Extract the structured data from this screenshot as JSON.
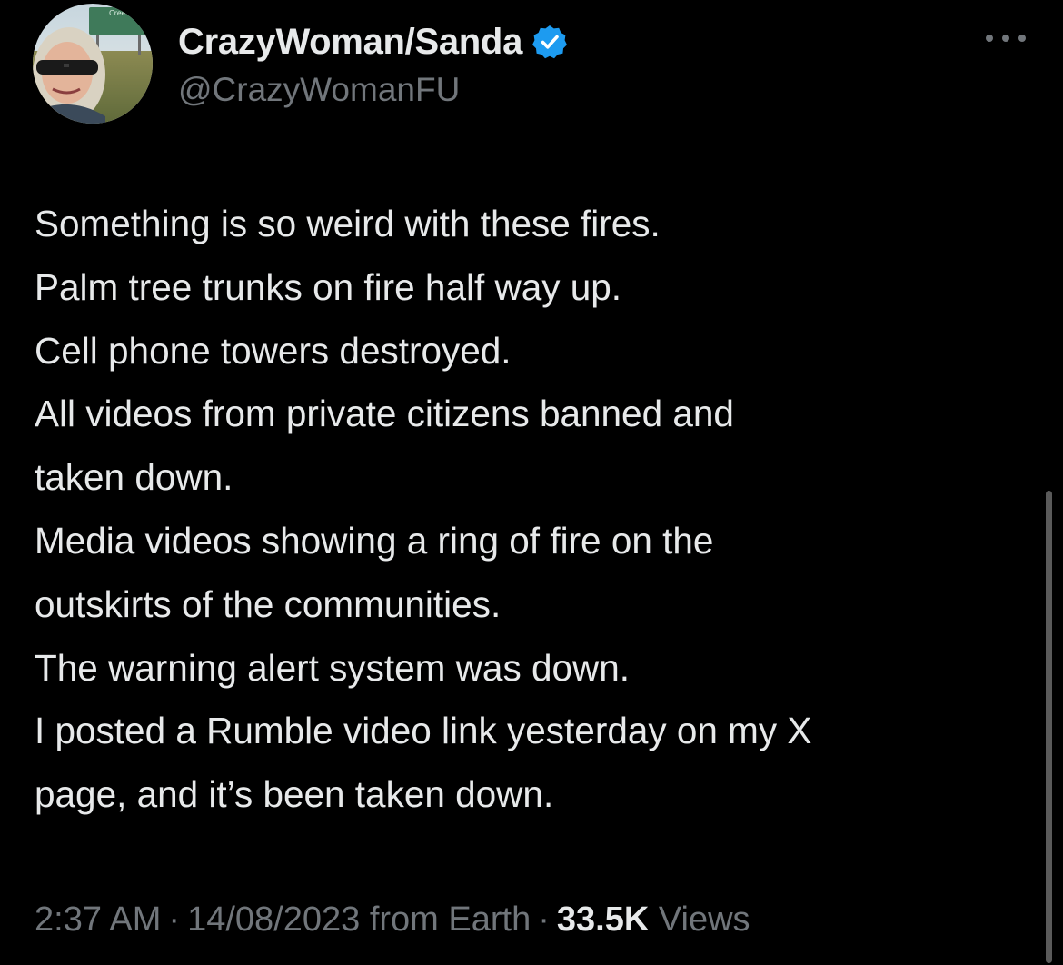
{
  "author": {
    "display_name": "CrazyWoman/Sanda",
    "handle": "@CrazyWomanFU",
    "verified": true,
    "avatar_sign_text": "Creek"
  },
  "more_icon": "more-horizontal-icon",
  "tweet": {
    "lines": [
      "Something is so weird with these fires.",
      "Palm tree trunks on fire half way up.",
      "Cell phone towers destroyed.",
      "All videos from private citizens banned and",
      "taken down.",
      "Media videos showing a ring of fire on the",
      "outskirts of the communities.",
      "The warning alert system was down.",
      "I posted a Rumble video link yesterday on my X",
      "page, and it’s been taken down."
    ]
  },
  "meta": {
    "time": "2:37 AM",
    "separator": "·",
    "date": "14/08/2023",
    "source": "from Earth",
    "views_count": "33.5K",
    "views_label": "Views"
  },
  "colors": {
    "background": "#000000",
    "text_primary": "#e7e9ea",
    "text_secondary": "#71767b",
    "verified_blue": "#1d9bf0"
  }
}
